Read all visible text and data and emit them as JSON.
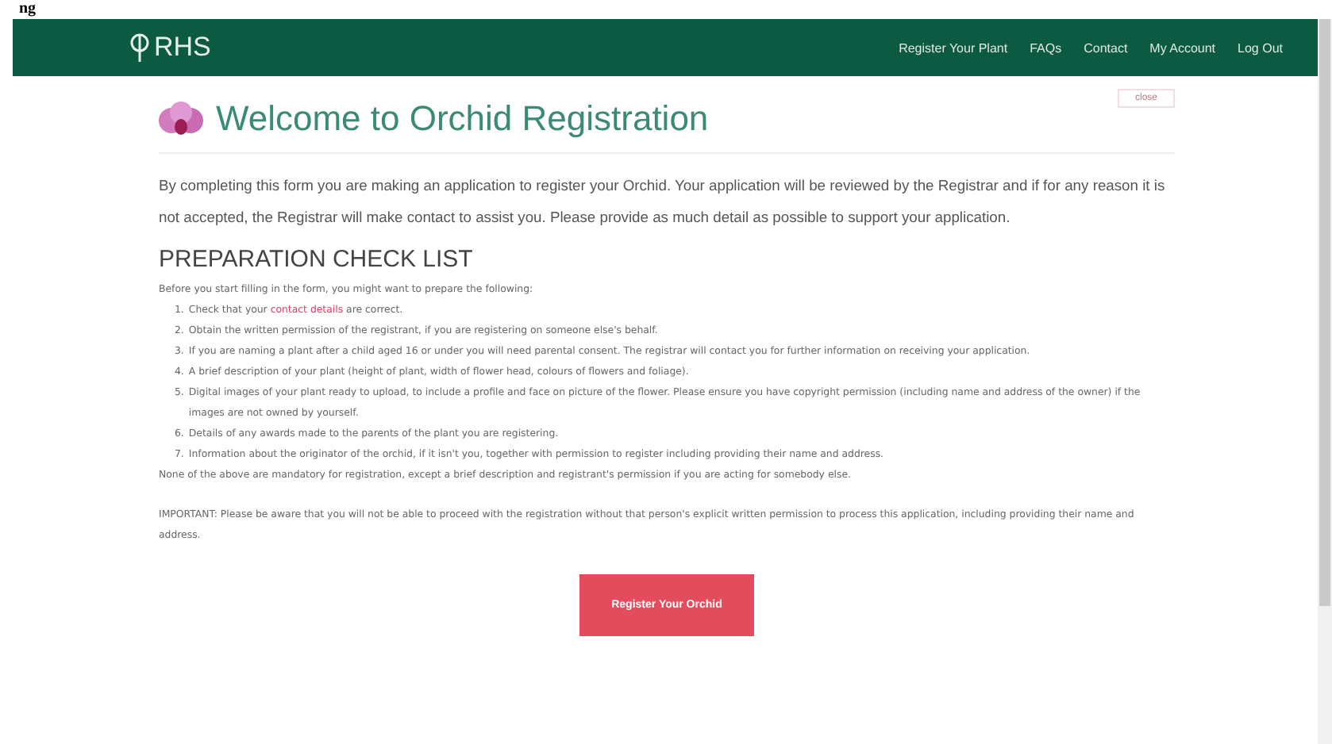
{
  "fragment": "ng",
  "navbar": {
    "logo": "RHS",
    "links": [
      {
        "label": "Register Your Plant"
      },
      {
        "label": "FAQs"
      },
      {
        "label": "Contact"
      },
      {
        "label": "My Account"
      },
      {
        "label": "Log Out"
      }
    ]
  },
  "header": {
    "title": "Welcome to Orchid Registration",
    "close_button": "close"
  },
  "intro": "By completing this form you are making an application to register your Orchid. Your application will be reviewed by the Registrar and if for any reason it is not accepted, the Registrar will make contact to assist you. Please provide as much detail as possible to support your application.",
  "checklist": {
    "heading": "PREPARATION CHECK LIST",
    "lead": "Before you start filling in the form, you might want to prepare the following:",
    "items": [
      {
        "number": "1.",
        "before": "Check that your",
        "link": "contact details",
        "after": "are correct."
      },
      {
        "number": "2.",
        "before": "Obtain the written permission of the registrant, if you are registering on someone else's behalf."
      },
      {
        "number": "3.",
        "before": "If you are naming a plant after a child aged 16 or under you will need parental consent. The registrar will contact you for further information on receiving your application."
      },
      {
        "number": "4.",
        "before": "A brief description of your plant (height of plant, width of flower head, colours of flowers and foliage)."
      },
      {
        "number": "5.",
        "before": "Digital images of your plant ready to upload, to include a profile and face on picture of the flower. Please ensure you have copyright permission (including name and address of the owner) if the images are not owned by yourself."
      },
      {
        "number": "6.",
        "before": "Details of any awards made to the parents of the plant you are registering."
      },
      {
        "number": "7.",
        "before": "Information about the originator of the orchid, if it isn't you, together with permission to register including providing their name and address."
      }
    ],
    "note": "None of the above are mandatory for registration, except a brief description and registrant's permission if you are acting for somebody else.",
    "important": "IMPORTANT: Please be aware that you will not be able to proceed with the registration without that person's explicit written permission to process this application, including providing their name and address."
  },
  "register_button": "Register Your Orchid"
}
